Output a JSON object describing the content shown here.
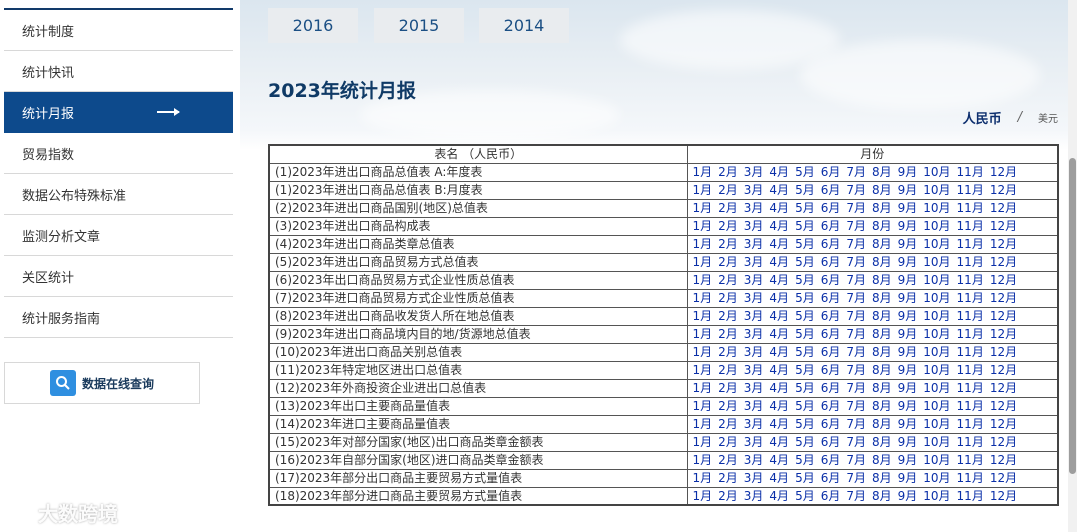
{
  "sidebar": {
    "items": [
      {
        "label": "统计制度",
        "active": false
      },
      {
        "label": "统计快讯",
        "active": false
      },
      {
        "label": "统计月报",
        "active": true
      },
      {
        "label": "贸易指数",
        "active": false
      },
      {
        "label": "数据公布特殊标准",
        "active": false
      },
      {
        "label": "监测分析文章",
        "active": false
      },
      {
        "label": "关区统计",
        "active": false
      },
      {
        "label": "统计服务指南",
        "active": false
      }
    ],
    "query_button": "数据在线查询"
  },
  "year_tabs": [
    "2016",
    "2015",
    "2014"
  ],
  "page_title": "2023年统计月报",
  "currency": {
    "rmb": "人民币",
    "sep": "/",
    "usd": "美元"
  },
  "table": {
    "headers": [
      "表名 （人民币）",
      "月份"
    ],
    "months": [
      "1月",
      "2月",
      "3月",
      "4月",
      "5月",
      "6月",
      "7月",
      "8月",
      "9月",
      "10月",
      "11月",
      "12月"
    ],
    "rows": [
      "(1)2023年进出口商品总值表 A:年度表",
      "(1)2023年进出口商品总值表 B:月度表",
      "(2)2023年进出口商品国别(地区)总值表",
      "(3)2023年进出口商品构成表",
      "(4)2023年进出口商品类章总值表",
      "(5)2023年进出口商品贸易方式总值表",
      "(6)2023年出口商品贸易方式企业性质总值表",
      "(7)2023年进口商品贸易方式企业性质总值表",
      "(8)2023年进出口商品收发货人所在地总值表",
      "(9)2023年进出口商品境内目的地/货源地总值表",
      "(10)2023年进出口商品关别总值表",
      "(11)2023年特定地区进出口总值表",
      "(12)2023年外商投资企业进出口总值表",
      "(13)2023年出口主要商品量值表",
      "(14)2023年进口主要商品量值表",
      "(15)2023年对部分国家(地区)出口商品类章金额表",
      "(16)2023年自部分国家(地区)进口商品类章金额表",
      "(17)2023年部分出口商品主要贸易方式量值表",
      "(18)2023年部分进口商品主要贸易方式量值表"
    ]
  },
  "watermark": "大数跨境",
  "colors": {
    "accent": "#0d4a8c",
    "link": "#0a2fa8",
    "title": "#0f3a66"
  }
}
